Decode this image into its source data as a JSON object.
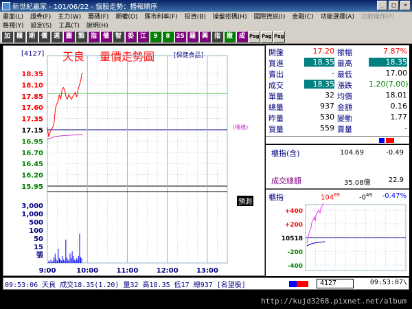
{
  "window": {
    "title": "新世紀贏家 - 101/06/22 - 個股走勢：播報順序",
    "buttons": [
      "_",
      "□",
      "×"
    ]
  },
  "menu_row1": [
    "畫面(L)",
    "證券(F)",
    "主力(W)",
    "籌碼(F)",
    "期權(O)",
    "匯市利率(F)",
    "投資(B)",
    "操盤密碼(H)",
    "國際資訊(I)",
    "金融(C)",
    "功能選擇(A)",
    "功能操作(P)"
  ],
  "menu_row2": [
    "格視(Y)",
    "設定(S)",
    "工具(T)",
    "說明(H)"
  ],
  "toolbar": [
    "加",
    "欄",
    "期",
    "價",
    "選",
    "圖",
    "類",
    "指",
    "備",
    "智",
    "委",
    "江",
    "9",
    "8",
    "25",
    "羅",
    "興",
    "指",
    "撤",
    "成",
    "Page",
    "Page",
    "Page"
  ],
  "colors": {
    "bg": "#000000",
    "panel": "#ffffff",
    "up": "#ff0000",
    "down": "#008000",
    "label": "#000080",
    "highlight": "#008080",
    "price_line": "#ff0000",
    "avg_line": "#cc33cc",
    "grid": "#9ab6c6",
    "volume": "#0000ff"
  },
  "stock": {
    "code": "[4127]",
    "name": "天良",
    "chart_title": "量價走勢圖",
    "category": "[保健食品]",
    "avg_tag": "(橢樣)",
    "ticker_label": "預測"
  },
  "quote": {
    "rows": [
      {
        "l1": "開盤",
        "v1": "17.20",
        "l2": "振幅",
        "v2": "7.87%"
      },
      {
        "l1": "買進",
        "v1": "18.35",
        "l2": "最高",
        "v2": "18.35"
      },
      {
        "l1": "賣出",
        "v1": "-",
        "l2": "最低",
        "v2": "17.00"
      },
      {
        "l1": "成交",
        "v1": "18.35",
        "l2": "漲跌",
        "v2": "1.20(7.00)"
      },
      {
        "l1": "單量",
        "v1": "32",
        "l2": "均價",
        "v2": "18.01"
      },
      {
        "l1": "總量",
        "v1": "937",
        "l2": "金額",
        "v2": "0.16"
      },
      {
        "l1": "昨量",
        "v1": "530",
        "l2": "變動",
        "v2": "1.77"
      },
      {
        "l1": "買量",
        "v1": "559",
        "l2": "賣量",
        "v2": "-"
      }
    ]
  },
  "index_box": {
    "label1": "櫃指(含)",
    "value1": "104.69",
    "change1": "-0.49",
    "label2": "成交總額",
    "value2": "35.08億",
    "change2": "22.9"
  },
  "mini_chart": {
    "label": "櫃指",
    "value": "104",
    "value_sup": "69",
    "change": "-0",
    "change_sup": "49",
    "pct": "-0.47%",
    "ylabels": [
      "+400",
      "+200",
      "10518",
      "-200",
      "-400"
    ]
  },
  "status": {
    "text": "09:53:06 天良 成交18.35(1.20) 量32 高18.35 低17 總937 [名望股]",
    "code_box": "4127",
    "clock": "09:53:07\\"
  },
  "credit": "http://kujd3268.pixnet.net/album",
  "chart_data": {
    "type": "line",
    "yticks": [
      "18.35",
      "18.10",
      "17.85",
      "17.60",
      "17.35",
      "17.15",
      "16.95",
      "16.70",
      "16.45",
      "16.20",
      "15.95"
    ],
    "xticks": [
      "9:00",
      "10:00",
      "11:00",
      "12:00",
      "13:00"
    ],
    "volume_ticks": [
      "3,000",
      "1,000",
      "500",
      "100",
      "50",
      "15",
      "張"
    ],
    "reference_price": 17.15,
    "series": [
      {
        "x": [
          0,
          2,
          4,
          6,
          8,
          10,
          12,
          14,
          16,
          18,
          20,
          22,
          24,
          26,
          28,
          30,
          32,
          34,
          36,
          38,
          40,
          42,
          44,
          46,
          48,
          50,
          52,
          53
        ],
        "values": [
          17.2,
          17.0,
          17.1,
          17.15,
          17.2,
          17.3,
          17.6,
          17.7,
          17.75,
          17.9,
          17.8,
          18.0,
          18.05,
          18.0,
          17.85,
          17.8,
          17.9,
          17.85,
          17.8,
          17.85,
          17.9,
          17.95,
          17.85,
          18.0,
          18.1,
          18.2,
          18.35,
          18.35
        ]
      },
      {
        "x": [
          0,
          5,
          10,
          20,
          30,
          40,
          53
        ],
        "values": [
          16.95,
          16.97,
          17.0,
          17.02,
          17.03,
          17.04,
          17.05
        ]
      }
    ],
    "volumes": [
      2,
      1,
      3,
      1,
      2,
      5,
      8,
      3,
      2,
      12,
      4,
      3,
      2,
      6,
      3,
      2,
      20,
      5,
      3,
      2,
      8,
      4,
      10,
      6,
      3,
      2,
      4,
      3,
      6,
      25,
      5,
      4
    ]
  }
}
